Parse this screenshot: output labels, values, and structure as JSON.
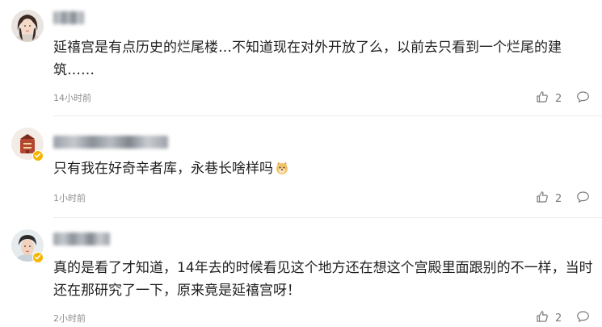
{
  "comments": [
    {
      "content": "延禧宫是有点历史的烂尾楼…不知道现在对外开放了么，以前去只看到一个烂尾的建筑……",
      "time": "14小时前",
      "likes": "2",
      "icons": {
        "avatar": "avatar-photo",
        "like": "thumbs-up-icon",
        "reply": "comment-bubble-icon"
      }
    },
    {
      "content": "只有我在好奇辛者库，永巷长啥样吗",
      "time": "1小时前",
      "likes": "2",
      "icons": {
        "avatar": "avatar-photo",
        "badge": "verified-badge-icon",
        "emoji": "doge-emoji-icon",
        "like": "thumbs-up-icon",
        "reply": "comment-bubble-icon"
      }
    },
    {
      "content": "真的是看了才知道，14年去的时候看见这个地方还在想这个宫殿里面跟别的不一样，当时还在那研究了一下，原来竟是延禧宫呀！",
      "time": "2小时前",
      "likes": "2",
      "icons": {
        "avatar": "avatar-photo",
        "badge": "verified-badge-icon",
        "like": "thumbs-up-icon",
        "reply": "comment-bubble-icon"
      }
    }
  ],
  "colors": {
    "text": "#1f1f1f",
    "meta": "#8e8e8e",
    "badge": "#f7b500",
    "divider": "#ececec"
  }
}
